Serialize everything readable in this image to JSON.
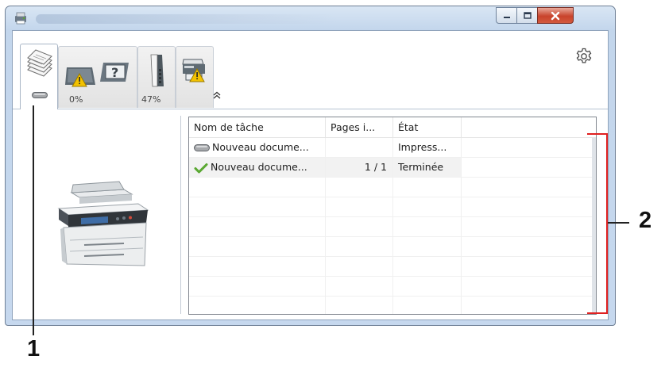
{
  "window": {
    "controls": {
      "minimize_icon": "minimize-icon",
      "maximize_icon": "maximize-icon",
      "close_icon": "close-icon"
    }
  },
  "tabs": [
    {
      "icon": "job-stack-icon",
      "status_icon": "status-led-icon",
      "percent": ""
    },
    {
      "icon": "toner-warning-icon",
      "percent": "0%"
    },
    {
      "icon": "paper-level-icon",
      "percent": "47%"
    },
    {
      "icon": "device-warning-icon",
      "percent": ""
    }
  ],
  "settings_icon": "gear-icon",
  "collapse_icon": "chevron-up-icon",
  "job_list": {
    "columns": [
      "Nom de tâche",
      "Pages i...",
      "État",
      ""
    ],
    "rows": [
      {
        "icon": "printing-led-icon",
        "name": "Nouveau docume...",
        "pages": "",
        "state": "Impress..."
      },
      {
        "icon": "checkmark-icon",
        "name": "Nouveau docume...",
        "pages": "1 / 1",
        "state": "Terminée"
      }
    ]
  },
  "callouts": {
    "one": "1",
    "two": "2"
  },
  "colors": {
    "accent_close": "#c8432c",
    "callout_red": "#e02020",
    "led_gray": "#a7a9ac",
    "check_green": "#5aa832"
  }
}
